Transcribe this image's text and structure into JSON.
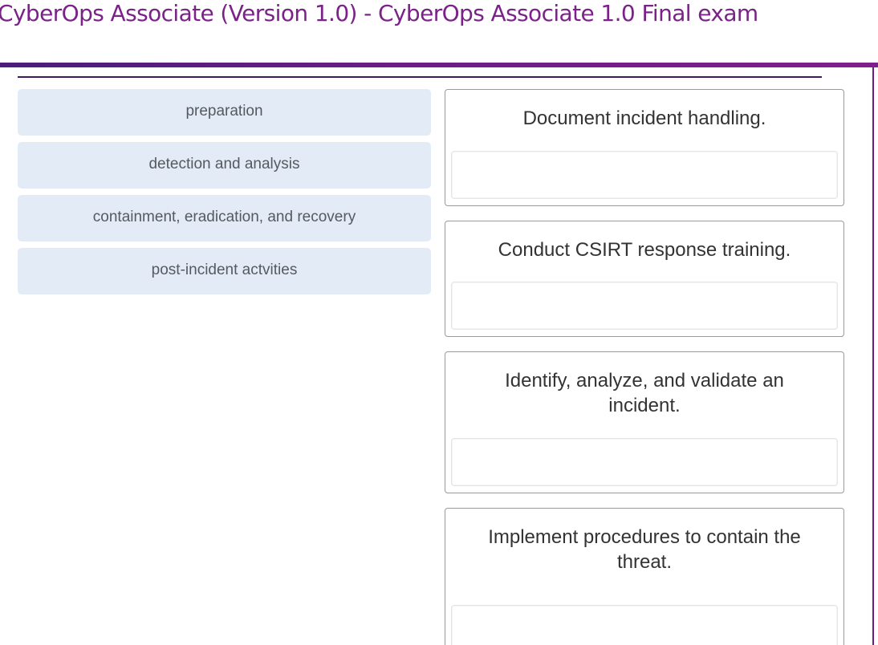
{
  "page": {
    "title": "CyberOps Associate (Version 1.0) - CyberOps Associate 1.0 Final exam"
  },
  "options": [
    {
      "label": "preparation"
    },
    {
      "label": "detection and analysis"
    },
    {
      "label": "containment, eradication, and recovery"
    },
    {
      "label": "post-incident actvities"
    }
  ],
  "targets": [
    {
      "label": "Document incident handling."
    },
    {
      "label": "Conduct CSIRT response training."
    },
    {
      "label": "Identify, analyze, and validate an incident."
    },
    {
      "label": "Implement procedures to contain the threat."
    }
  ],
  "colors": {
    "title": "#7a2288",
    "accent_bar": "#6a1e86",
    "option_bg": "#e3ebf6"
  }
}
